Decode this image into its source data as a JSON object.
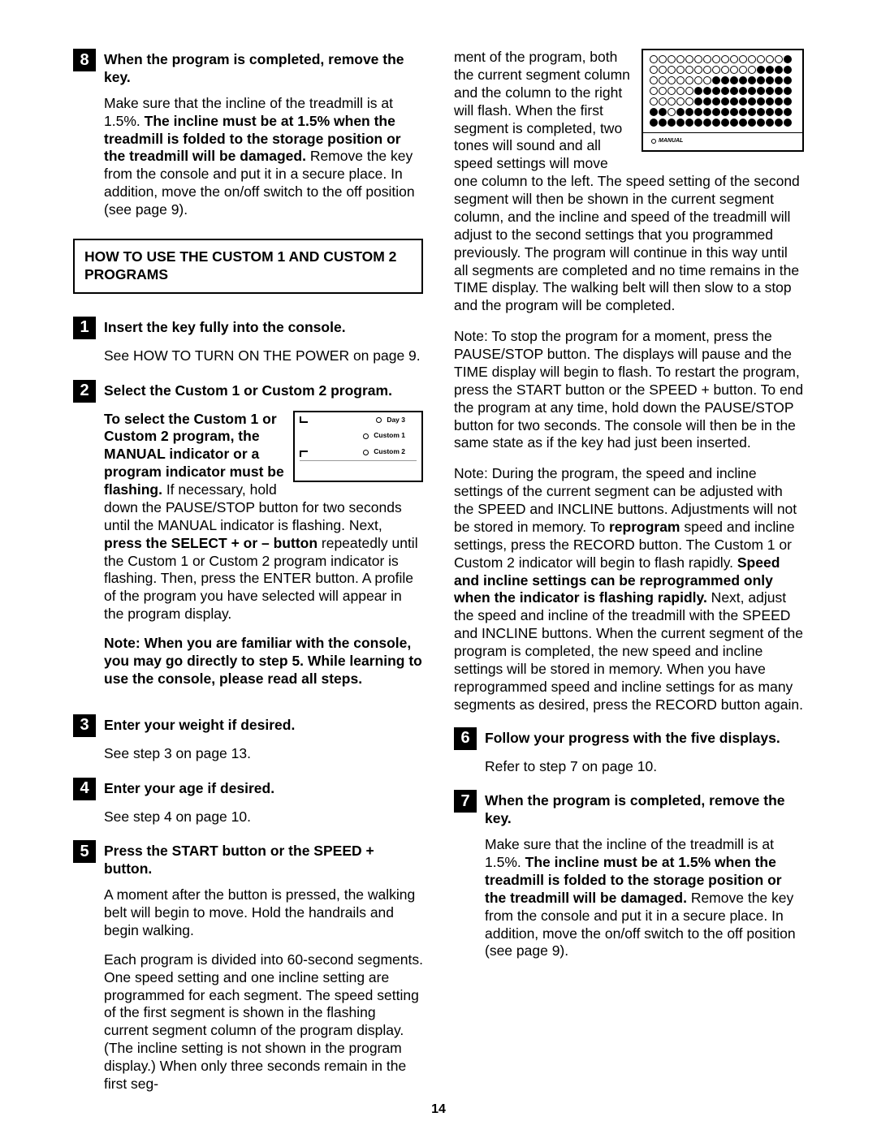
{
  "page_number": "14",
  "left": {
    "step8": {
      "num": "8",
      "title": "When the program is completed, remove the key.",
      "body_pre": "Make sure that the incline of the treadmill is at 1.5%. ",
      "body_bold": "The incline must be at 1.5% when the treadmill is folded to the storage position or the treadmill will be damaged.",
      "body_post": " Remove the key from the console and put it in a secure place. In addition, move the on/off switch to the off position (see page 9)."
    },
    "howto_box": "HOW TO USE THE CUSTOM 1 AND CUSTOM 2 PROGRAMS",
    "step1": {
      "num": "1",
      "title": "Insert the key fully into the console.",
      "body": "See HOW TO TURN ON THE POWER on page 9."
    },
    "step2": {
      "num": "2",
      "title": "Select the Custom 1 or Custom 2  program.",
      "body_bold1": "To select the Custom 1 or Custom 2 program, the MANUAL indicator or a program indicator must be flashing.",
      "body_mid1": " If necessary, hold down the PAUSE/STOP button for two seconds until the MANUAL indicator is flashing. Next, ",
      "body_bold2": "press the SELECT + or – button",
      "body_post1": " repeatedly until the Custom 1 or Custom 2 program indicator is flashing. Then, press the ENTER button. A profile of the program you have selected will appear in the program display.",
      "note": "Note: When you are familiar with the console, you may go directly to step 5. While learning to use the console, please read all steps.",
      "img": {
        "line1": "Day 3",
        "line2": "Custom 1",
        "line3": "Custom 2"
      }
    },
    "step3": {
      "num": "3",
      "title": "Enter your weight if desired.",
      "body": "See step 3 on page 13."
    },
    "step4": {
      "num": "4",
      "title": "Enter your age if desired.",
      "body": "See step 4 on page 10."
    },
    "step5": {
      "num": "5",
      "title": "Press the START button or the SPEED + button.",
      "p1": "A moment after the button is pressed, the walking belt will begin to move. Hold the handrails and begin walking.",
      "p2": "Each program is divided into 60-second segments. One speed setting and one incline setting are programmed for each segment. The speed setting of the first segment is shown in the flashing current segment column of the program display. (The incline setting is not shown in the program display.) When only three seconds remain in the first seg-"
    }
  },
  "right": {
    "cont": "ment of the program, both the current segment column and the column to the right will flash. When the first segment is completed, two tones will sound and all speed settings will move one column to the left. The speed setting of the second segment will then be shown in the current segment column, and the incline and speed of the treadmill will adjust to the second settings that you programmed previously. The program will continue in this way until all segments are completed and no time remains in the TIME display. The walking belt will then slow to a stop and the program will be completed.",
    "display_manual": "MANUAL",
    "note1": "Note: To stop the program for a moment, press the PAUSE/STOP button. The displays will pause and the TIME display will begin to flash. To restart the program, press the START button or the SPEED + button. To end the program at any time, hold down the PAUSE/STOP button for two seconds. The console will then be in the same state as if the key had just been inserted.",
    "note2_pre": "Note: During the program, the speed and incline settings of the current segment can be adjusted with the SPEED and INCLINE buttons. Adjustments will not be stored in memory. To ",
    "note2_b1": "reprogram",
    "note2_mid": " speed and incline settings, press the RECORD button. The Custom 1 or Custom 2 indicator will begin to flash rapidly. ",
    "note2_b2": "Speed and incline settings can be reprogrammed only when the indicator is flashing rapidly.",
    "note2_post": " Next, adjust the speed and incline of the treadmill with the SPEED and INCLINE buttons. When the current segment of the program is completed, the new speed and incline settings will be stored in memory. When you have reprogrammed speed and incline settings for as many segments as desired, press the RECORD button again.",
    "step6": {
      "num": "6",
      "title": "Follow your progress with the five displays.",
      "body": "Refer to step 7 on page 10."
    },
    "step7": {
      "num": "7",
      "title": "When the program is completed, remove the key.",
      "body_pre": "Make sure that the incline of the treadmill is at 1.5%. ",
      "body_bold": "The incline must be at 1.5% when the treadmill is folded to the storage position or the treadmill will be damaged.",
      "body_post": " Remove the key from the console and put it in a secure place. In addition, move the on/off switch to the off position (see page 9)."
    }
  }
}
